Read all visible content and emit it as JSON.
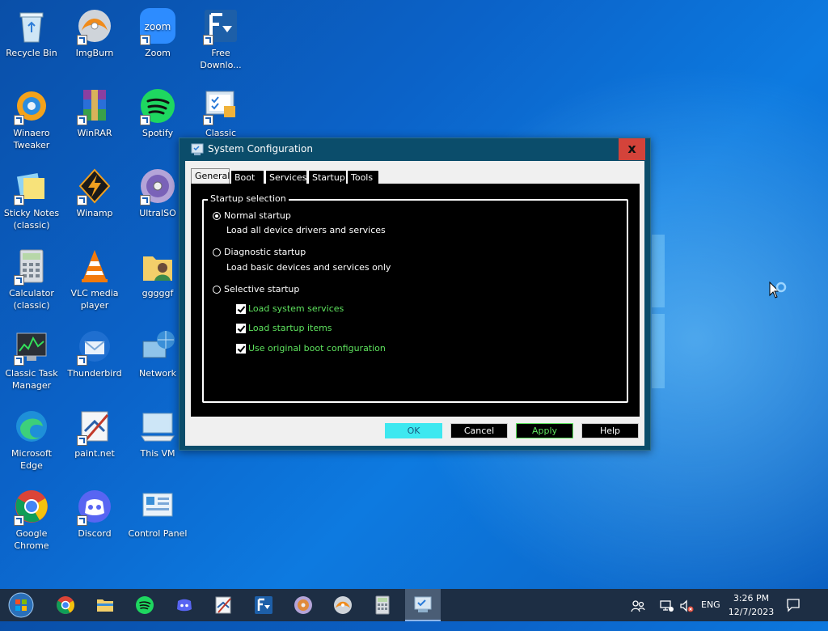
{
  "desktop": {
    "icons": [
      {
        "label": "Recycle Bin"
      },
      {
        "label": "ImgBurn"
      },
      {
        "label": "Zoom"
      },
      {
        "label": "Free Downlo..."
      },
      {
        "label": "Winaero Tweaker"
      },
      {
        "label": "WinRAR"
      },
      {
        "label": "Spotify"
      },
      {
        "label": "Classic"
      },
      {
        "label": "Sticky Notes (classic)"
      },
      {
        "label": "Winamp"
      },
      {
        "label": "UltraISO"
      },
      {
        "label": "Calculator (classic)"
      },
      {
        "label": "VLC media player"
      },
      {
        "label": "gggggf"
      },
      {
        "label": "Classic Task Manager"
      },
      {
        "label": "Thunderbird"
      },
      {
        "label": "Network"
      },
      {
        "label": "Microsoft Edge"
      },
      {
        "label": "paint.net"
      },
      {
        "label": "This VM"
      },
      {
        "label": "Google Chrome"
      },
      {
        "label": "Discord"
      },
      {
        "label": "Control Panel"
      }
    ]
  },
  "dialog": {
    "title": "System Configuration",
    "close": "x",
    "tabs": [
      "General",
      "Boot",
      "Services",
      "Startup",
      "Tools"
    ],
    "active_tab": "General",
    "group_title": "Startup selection",
    "normal": {
      "label": "Normal startup",
      "desc": "Load all device drivers and services",
      "selected": true
    },
    "diagnostic": {
      "label": "Diagnostic startup",
      "desc": "Load basic devices and services only",
      "selected": false
    },
    "selective": {
      "label": "Selective startup",
      "selected": false
    },
    "checks": [
      {
        "label": "Load system services",
        "checked": true
      },
      {
        "label": "Load startup items",
        "checked": true
      },
      {
        "label": "Use original boot configuration",
        "checked": true
      }
    ],
    "buttons": {
      "ok": "OK",
      "cancel": "Cancel",
      "apply": "Apply",
      "help": "Help"
    }
  },
  "taskbar": {
    "language": "ENG",
    "time": "3:26 PM",
    "date": "12/7/2023"
  }
}
